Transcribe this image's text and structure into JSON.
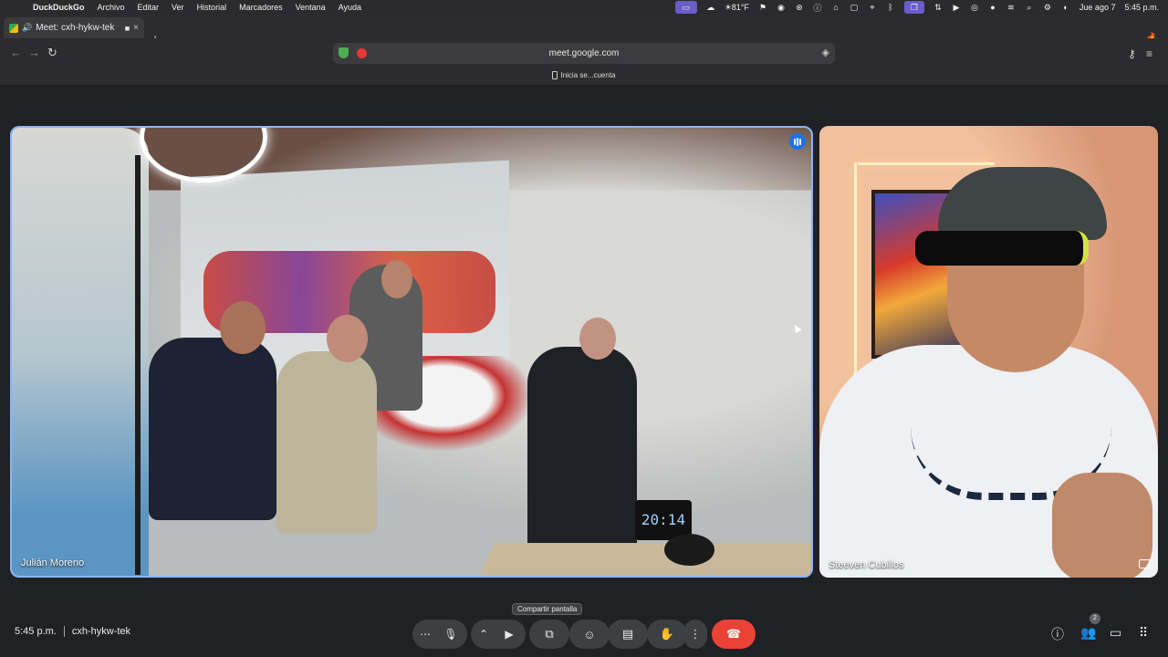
{
  "menubar": {
    "app": "DuckDuckGo",
    "items": [
      "Archivo",
      "Editar",
      "Ver",
      "Historial",
      "Marcadores",
      "Ventana",
      "Ayuda"
    ],
    "weather": "☀81°F",
    "date": "Jue ago 7",
    "time": "5:45 p.m."
  },
  "tab": {
    "title": "Meet: cxh-hykw-tek",
    "close": "×",
    "new": "+"
  },
  "address": {
    "url": "meet.google.com",
    "subtitle": "Inicia se...cuenta"
  },
  "participants": [
    {
      "name": "Julián Moreno"
    },
    {
      "name": "Steeven Cubillos"
    }
  ],
  "video": {
    "clock_display": "20:14"
  },
  "tooltip": "Compartir pantalla",
  "footer": {
    "time": "5:45 p.m.",
    "meeting_code": "cxh-hykw-tek",
    "people_count": "2"
  },
  "colors": {
    "end_call": "#ea4335",
    "active_speaker": "#8ab4f8",
    "accent": "#1a73e8"
  }
}
